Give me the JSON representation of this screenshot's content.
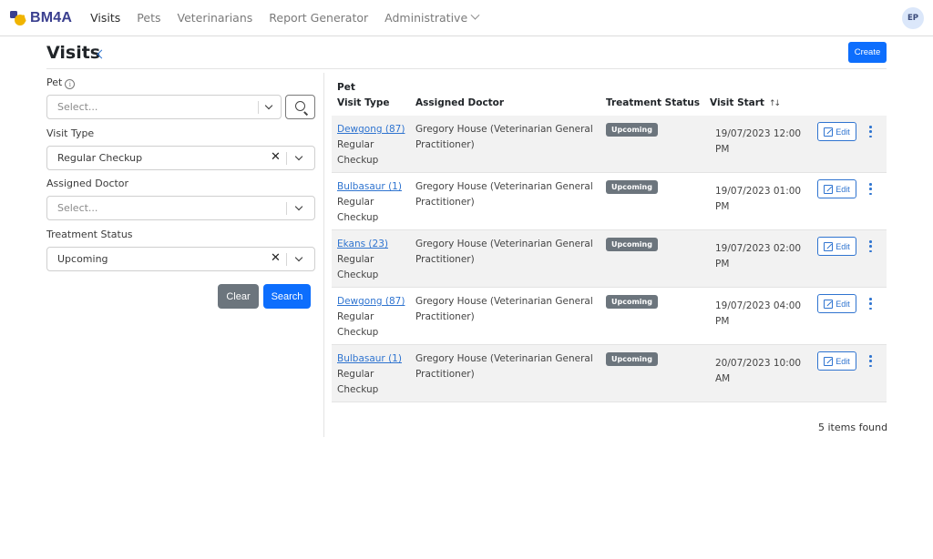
{
  "nav": {
    "brand": "BM4A",
    "items": [
      {
        "label": "Visits",
        "active": true
      },
      {
        "label": "Pets",
        "active": false
      },
      {
        "label": "Veterinarians",
        "active": false
      },
      {
        "label": "Report Generator",
        "active": false
      },
      {
        "label": "Administrative",
        "active": false,
        "dropdown": true
      }
    ],
    "avatar": "EP"
  },
  "page": {
    "title": "Visits",
    "create_label": "Create"
  },
  "filters": {
    "pet": {
      "label": "Pet",
      "placeholder": "Select..."
    },
    "visit_type": {
      "label": "Visit Type",
      "value": "Regular Checkup"
    },
    "doctor": {
      "label": "Assigned Doctor",
      "placeholder": "Select..."
    },
    "status": {
      "label": "Treatment Status",
      "value": "Upcoming"
    },
    "clear_label": "Clear",
    "search_label": "Search"
  },
  "table": {
    "headers": {
      "pet": "Pet",
      "visit_type": "Visit Type",
      "doctor": "Assigned Doctor",
      "status": "Treatment Status",
      "start": "Visit Start",
      "sort_icon": "↑↓"
    },
    "edit_label": "Edit",
    "rows": [
      {
        "pet": "Dewgong (87)",
        "type_1": "Regular",
        "type_2": "Checkup",
        "doc_1": "Gregory House (Veterinarian General",
        "doc_2": "Practitioner)",
        "status": "Upcoming",
        "start_1": "19/07/2023 12:00",
        "start_2": "PM"
      },
      {
        "pet": "Bulbasaur (1)",
        "type_1": "Regular",
        "type_2": "Checkup",
        "doc_1": "Gregory House (Veterinarian General",
        "doc_2": "Practitioner)",
        "status": "Upcoming",
        "start_1": "19/07/2023 01:00",
        "start_2": "PM"
      },
      {
        "pet": "Ekans (23)",
        "type_1": "Regular",
        "type_2": "Checkup",
        "doc_1": "Gregory House (Veterinarian General",
        "doc_2": "Practitioner)",
        "status": "Upcoming",
        "start_1": "19/07/2023 02:00",
        "start_2": "PM"
      },
      {
        "pet": "Dewgong (87)",
        "type_1": "Regular",
        "type_2": "Checkup",
        "doc_1": "Gregory House (Veterinarian General",
        "doc_2": "Practitioner)",
        "status": "Upcoming",
        "start_1": "19/07/2023 04:00",
        "start_2": "PM"
      },
      {
        "pet": "Bulbasaur (1)",
        "type_1": "Regular",
        "type_2": "Checkup",
        "doc_1": "Gregory House (Veterinarian General",
        "doc_2": "Practitioner)",
        "status": "Upcoming",
        "start_1": "20/07/2023 10:00",
        "start_2": "AM"
      }
    ],
    "items_found": "5 items found"
  },
  "colors": {
    "primary": "#0d6efd",
    "secondary": "#6c757d",
    "link": "#2f74d0",
    "brand": "#3a3f8f"
  }
}
